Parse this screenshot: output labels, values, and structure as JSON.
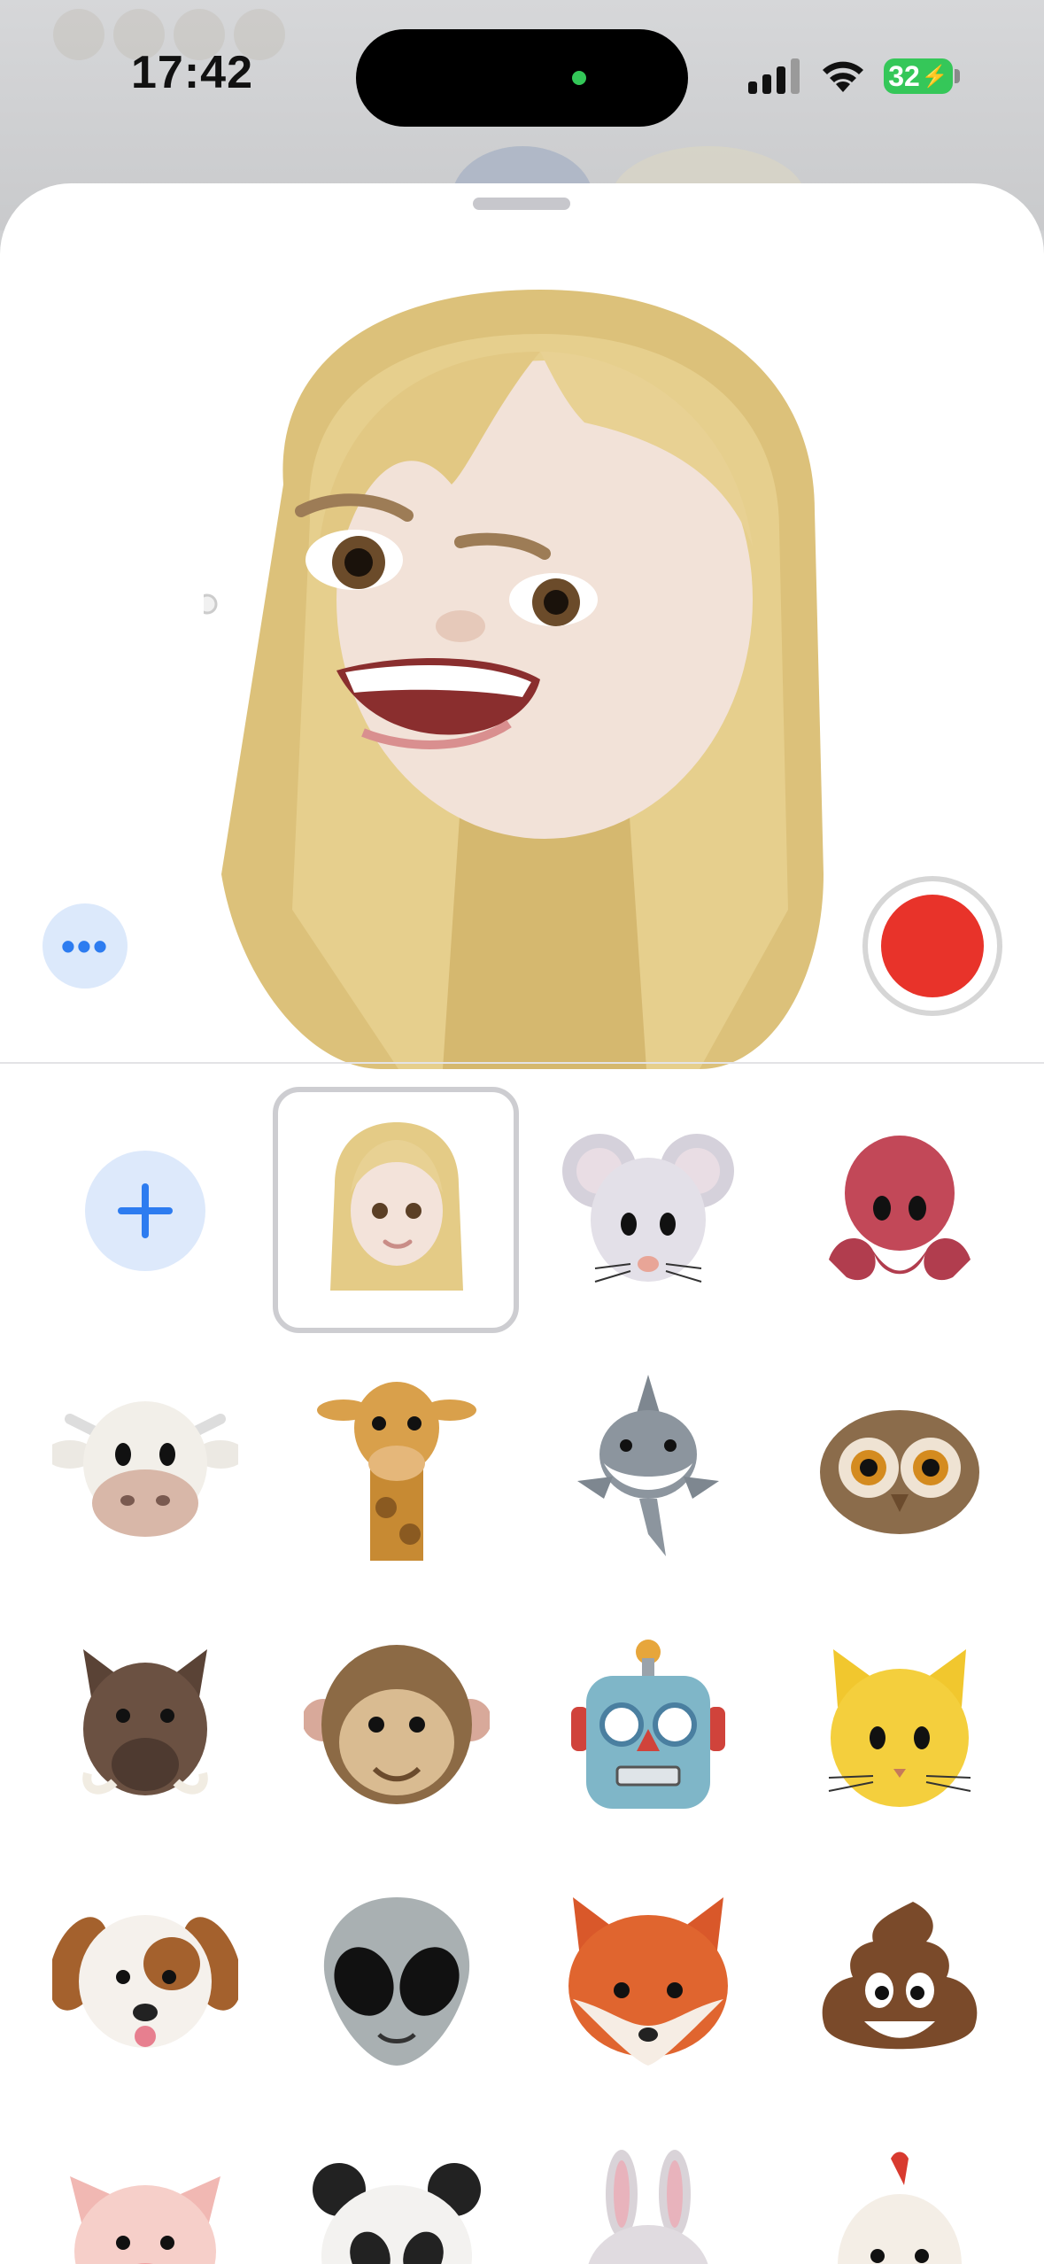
{
  "status_bar": {
    "time": "17:42",
    "battery": "32",
    "icons": [
      "signal-icon",
      "wifi-icon",
      "battery-charging-icon"
    ]
  },
  "preview": {
    "selected_character": "memoji-blonde",
    "more_button_label": "•••",
    "record_button_color": "#e8332a"
  },
  "sticker_grid": {
    "add_button_icon": "plus-icon",
    "items": [
      "memoji",
      "mouse",
      "octopus",
      "cow",
      "giraffe",
      "shark",
      "owl",
      "boar",
      "monkey",
      "robot",
      "cat",
      "dog",
      "alien",
      "fox",
      "poo",
      "pig",
      "panda",
      "rabbit",
      "chicken"
    ]
  },
  "colors": {
    "accent": "#2d7cf0",
    "record": "#e8332a"
  }
}
